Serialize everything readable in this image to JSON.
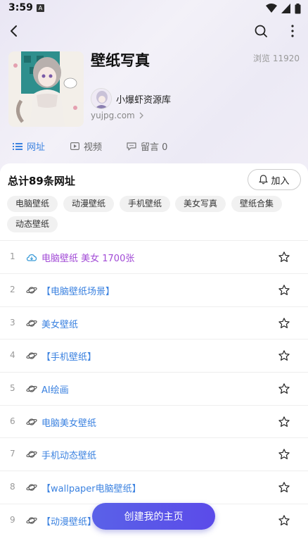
{
  "status_bar": {
    "time": "3:59",
    "a_badge": "A"
  },
  "header": {
    "back_icon": "back-arrow-icon",
    "search_icon": "search-icon",
    "more_icon": "more-vertical-icon"
  },
  "collection": {
    "title": "壁纸写真",
    "views": "浏览 11920",
    "author": "小爆虾资源库",
    "site": "yujpg.com"
  },
  "tabs": [
    {
      "label": "网址",
      "icon": "list-icon",
      "active": true
    },
    {
      "label": "视频",
      "icon": "video-icon"
    },
    {
      "label": "留言 0",
      "icon": "comment-icon"
    }
  ],
  "summary": {
    "total": "总计89条网址",
    "join": "加入"
  },
  "tags": [
    "电脑壁纸",
    "动漫壁纸",
    "手机壁纸",
    "美女写真",
    "壁纸合集",
    "动态壁纸"
  ],
  "items": [
    {
      "num": "1",
      "label": "电脑壁纸 美女 1700张",
      "icon": "cloud-icon"
    },
    {
      "num": "2",
      "label": "【电脑壁纸场景】",
      "icon": "planet-icon"
    },
    {
      "num": "3",
      "label": "美女壁纸",
      "icon": "planet-icon"
    },
    {
      "num": "4",
      "label": "【手机壁纸】",
      "icon": "planet-icon"
    },
    {
      "num": "5",
      "label": "AI绘画",
      "icon": "planet-icon"
    },
    {
      "num": "6",
      "label": "电脑美女壁纸",
      "icon": "planet-icon"
    },
    {
      "num": "7",
      "label": "手机动态壁纸",
      "icon": "planet-icon"
    },
    {
      "num": "8",
      "label": "【wallpaper电脑壁纸】",
      "icon": "planet-icon"
    },
    {
      "num": "9",
      "label": "【动漫壁纸】",
      "icon": "planet-icon"
    }
  ],
  "fab": {
    "label": "创建我的主页"
  },
  "colors": {
    "accent": "#3b82e0",
    "purple_link": "#a24bd6",
    "fab": "#5a58e8"
  }
}
